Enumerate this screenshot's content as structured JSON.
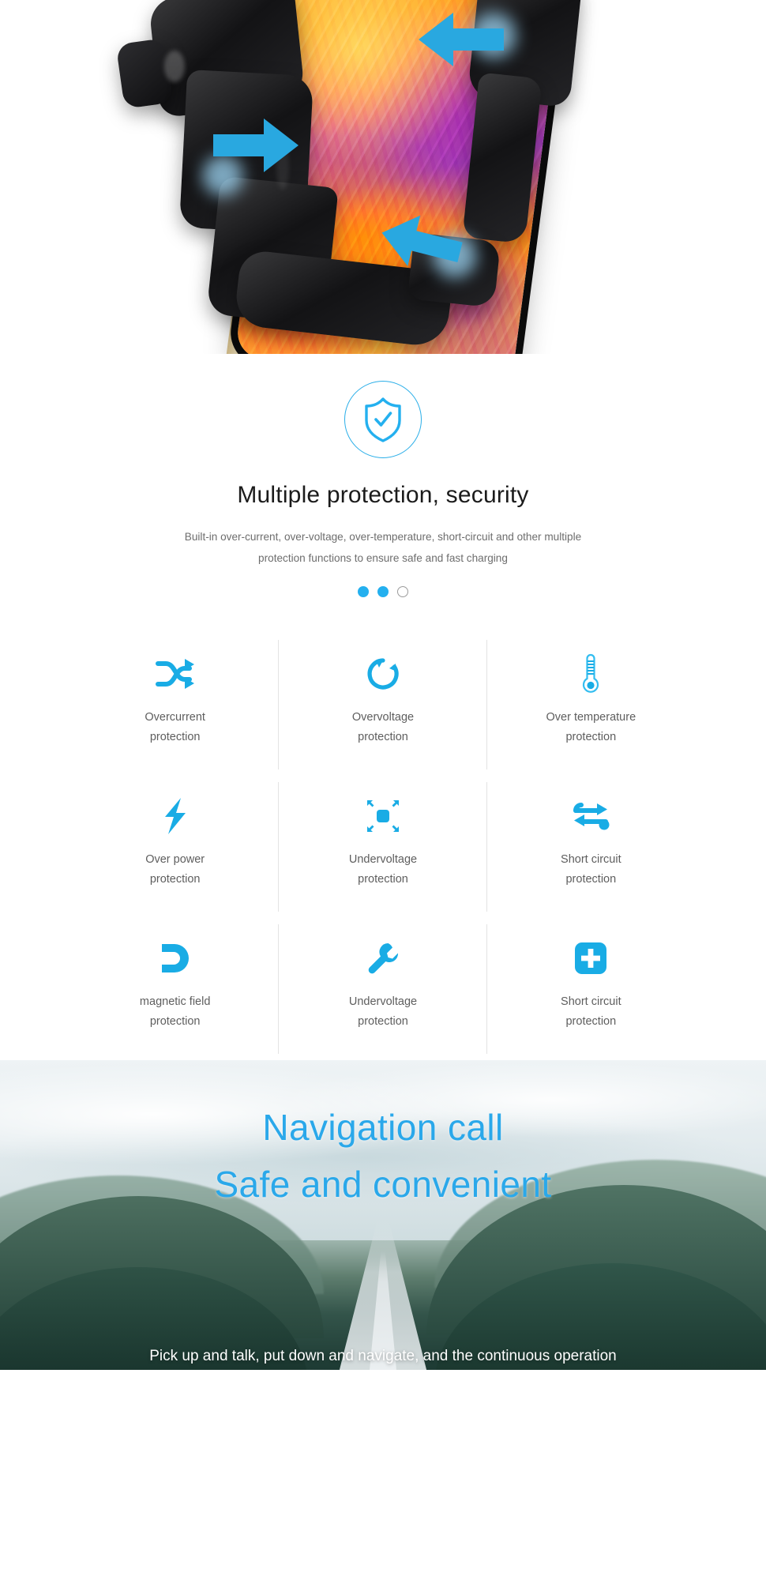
{
  "hero": {
    "alt": "Automatic clamping wireless car charger holder gripping a smartphone",
    "arrow_icons": [
      "arrow-right-icon",
      "arrow-left-icon",
      "arrow-left-down-icon"
    ]
  },
  "protection": {
    "badge_icon": "shield-check-icon",
    "title": "Multiple protection, security",
    "description_line1": "Built-in over-current, over-voltage, over-temperature, short-circuit and other multiple",
    "description_line2": "protection functions to ensure safe and fast charging",
    "accent_color": "#24b0ef",
    "carousel": {
      "dots": [
        "active",
        "active",
        "inactive"
      ],
      "active_count": 2,
      "total": 3
    },
    "features": [
      {
        "icon": "shuffle-arrows-icon",
        "line1": "Overcurrent",
        "line2": "protection"
      },
      {
        "icon": "refresh-circle-icon",
        "line1": "Overvoltage",
        "line2": "protection"
      },
      {
        "icon": "thermometer-icon",
        "line1": "Over temperature",
        "line2": "protection"
      },
      {
        "icon": "lightning-bolt-icon",
        "line1": "Over power",
        "line2": "protection"
      },
      {
        "icon": "expand-arrows-icon",
        "line1": "Undervoltage",
        "line2": "protection"
      },
      {
        "icon": "exchange-arrows-icon",
        "line1": "Short circuit",
        "line2": "protection"
      },
      {
        "icon": "magnet-icon",
        "line1": "magnetic field",
        "line2": "protection"
      },
      {
        "icon": "wrench-icon",
        "line1": "Undervoltage",
        "line2": "protection"
      },
      {
        "icon": "plus-square-icon",
        "line1": "Short circuit",
        "line2": "protection"
      }
    ]
  },
  "navigation": {
    "headline_line1": "Navigation call",
    "headline_line2": "Safe and convenient",
    "headline_color": "#2aa8ea",
    "caption": "Pick up and talk, put down and navigate, and the continuous operation",
    "background": "aerial highway through forested mountains"
  }
}
